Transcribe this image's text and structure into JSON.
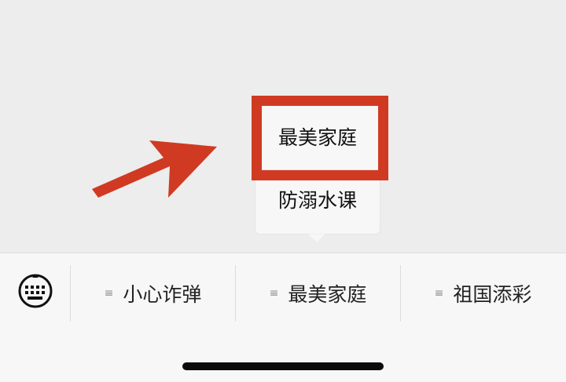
{
  "submenu": {
    "items": [
      {
        "label": "最美家庭"
      },
      {
        "label": "防溺水课"
      }
    ]
  },
  "menu_bar": {
    "keyboard_icon": "keyboard-icon",
    "tabs": [
      {
        "label": "小心诈弹",
        "icon": "hamburger-icon"
      },
      {
        "label": "最美家庭",
        "icon": "hamburger-icon"
      },
      {
        "label": "祖国添彩",
        "icon": "hamburger-icon"
      }
    ],
    "hamburger_glyph": "≡"
  },
  "colors": {
    "annotation": "#d03a22",
    "background": "#ededed",
    "menu_background": "#f7f7f7",
    "home_indicator": "#0b0b0b"
  }
}
